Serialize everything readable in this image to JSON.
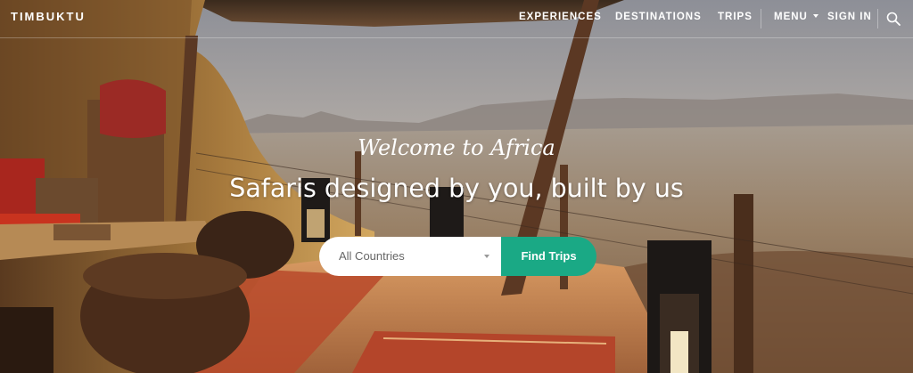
{
  "header": {
    "logo": "TIMBUKTU",
    "nav": {
      "experiences": "EXPERIENCES",
      "destinations": "DESTINATIONS",
      "trips": "TRIPS",
      "menu": "MENU",
      "sign_in": "SIGN IN"
    },
    "search_icon": "search-icon"
  },
  "hero": {
    "tagline": "Welcome to Africa",
    "headline": "Safaris designed by you, built by us",
    "background": "safari-lodge-photo"
  },
  "search": {
    "country_select": "All Countries",
    "button_label": "Find Trips"
  },
  "colors": {
    "accent": "#1aa985",
    "text_on_image": "#ffffff"
  }
}
